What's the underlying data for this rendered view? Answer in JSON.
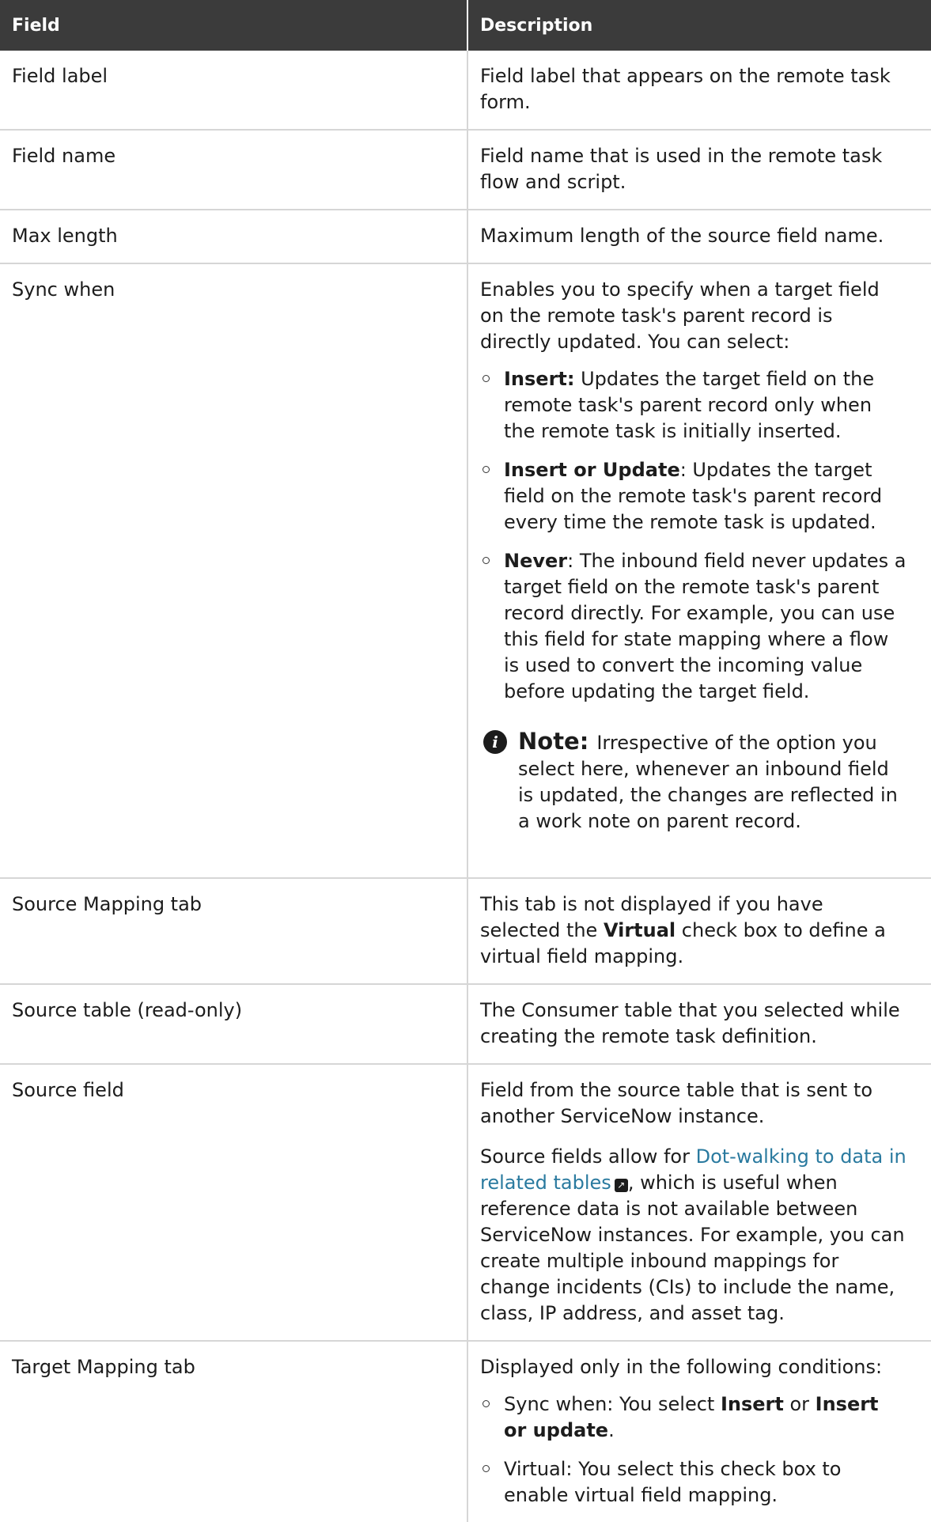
{
  "header": {
    "field": "Field",
    "description": "Description"
  },
  "rows": {
    "field_label": {
      "field": "Field label",
      "desc": "Field label that appears on the remote task form."
    },
    "field_name": {
      "field": "Field name",
      "desc": "Field name that is used in the remote task flow and script."
    },
    "max_length": {
      "field": "Max length",
      "desc": "Maximum length of the source field name."
    },
    "sync_when": {
      "field": "Sync when",
      "intro": "Enables you to specify when a target field on the remote task's parent record is directly updated. You can select:",
      "options": [
        {
          "term": "Insert:",
          "text": " Updates the target field on the remote task's parent record only when the remote task is initially inserted."
        },
        {
          "term": "Insert or Update",
          "text": ": Updates the target field on the remote task's parent record every time the remote task is updated."
        },
        {
          "term": "Never",
          "text": ": The inbound field never updates a target field on the remote task's parent record directly. For example, you can use this field for state mapping where a flow is used to convert the incoming value before updating the target field."
        }
      ],
      "note_label": "Note:",
      "note_text": "Irrespective of the option you select here, whenever an inbound field is updated, the changes are reflected in a work note on parent record."
    },
    "source_mapping_tab": {
      "field": "Source Mapping tab",
      "desc_before": "This tab is not displayed if you have selected the ",
      "desc_bold": "Virtual",
      "desc_after": " check box to define a virtual field mapping."
    },
    "source_table": {
      "field": "Source table (read-only)",
      "desc": "The Consumer table that you selected while creating the remote task definition."
    },
    "source_field": {
      "field": "Source field",
      "desc1": "Field from the source table that is sent to another ServiceNow instance.",
      "desc2_before": "Source fields allow for ",
      "desc2_link": "Dot-walking to data in related tables",
      "desc2_after": ", which is useful when reference data is not available between ServiceNow instances. For example, you can create multiple inbound mappings for change incidents (CIs) to include the name, class, IP address, and asset tag."
    },
    "target_mapping_tab": {
      "field": "Target Mapping tab",
      "intro": "Displayed only in the following conditions:",
      "cond1_before": "Sync when: You select ",
      "cond1_bold1": "Insert",
      "cond1_mid": " or ",
      "cond1_bold2": "Insert or update",
      "cond1_after": ".",
      "cond2": "Virtual: You select this check box to enable virtual field mapping."
    }
  },
  "colors": {
    "header_bg": "#3b3b3b",
    "link": "#2a7a9f",
    "border": "#d6d6d6"
  },
  "icons": {
    "note": "info-icon",
    "external_link": "external-link-icon"
  }
}
